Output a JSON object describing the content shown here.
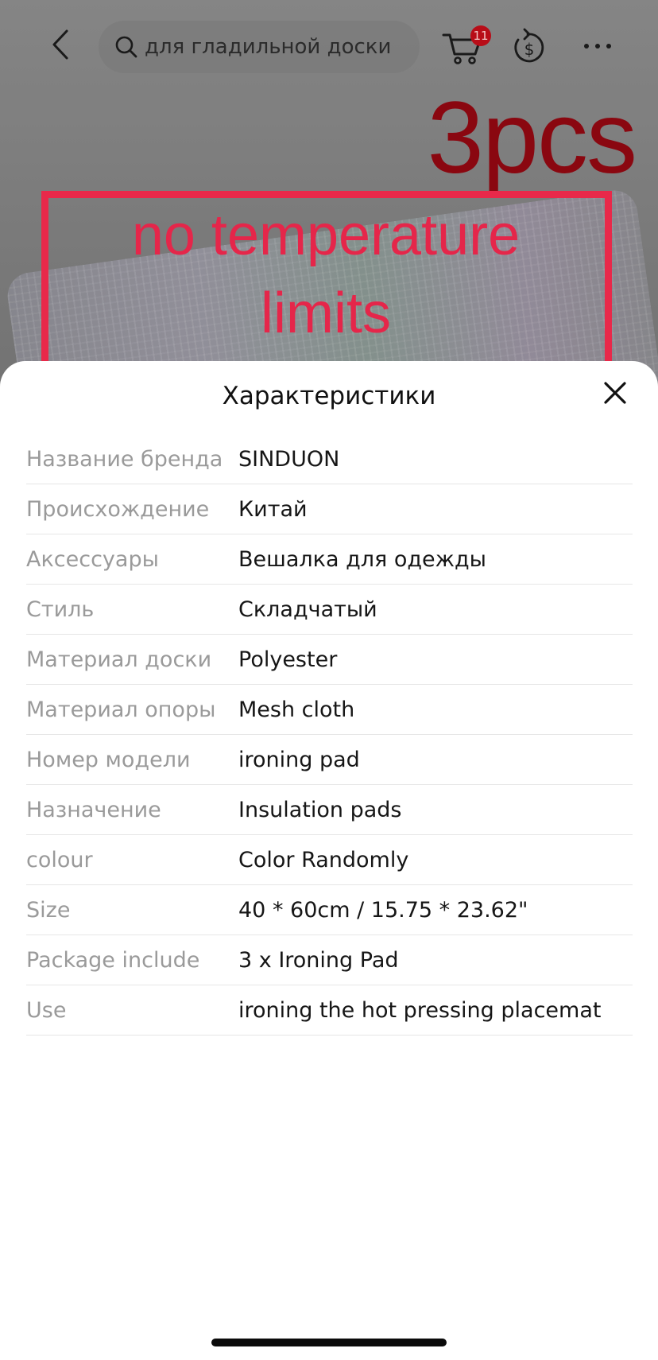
{
  "hero": {
    "overlay_pcs": "3pcs",
    "overlay_line1": "no temperature",
    "overlay_line2": "limits"
  },
  "nav": {
    "back_icon": "chevron-left-icon",
    "search_placeholder": "для гладильной доски",
    "cart_count": "11",
    "coin_icon": "coin-refresh-icon",
    "more_icon": "more-dots-icon"
  },
  "sheet": {
    "title": "Характеристики",
    "close_icon": "close-icon",
    "specs": [
      {
        "key": "Название бренда",
        "value": "SINDUON"
      },
      {
        "key": "Происхождение",
        "value": "Китай"
      },
      {
        "key": "Аксессуары",
        "value": "Вешалка для одежды"
      },
      {
        "key": "Стиль",
        "value": "Складчатый"
      },
      {
        "key": "Материал доски",
        "value": "Polyester"
      },
      {
        "key": "Материал опоры",
        "value": "Mesh cloth"
      },
      {
        "key": "Номер модели",
        "value": "ironing pad"
      },
      {
        "key": "Назначение",
        "value": "Insulation pads"
      },
      {
        "key": "colour",
        "value": "Color Randomly"
      },
      {
        "key": "Size",
        "value": "40 * 60cm / 15.75 * 23.62\""
      },
      {
        "key": "Package include",
        "value": "3 x Ironing Pad"
      },
      {
        "key": "Use",
        "value": "ironing the hot pressing placemat"
      }
    ]
  },
  "colors": {
    "accent_red": "#e8294a",
    "badge_red": "#b80d18",
    "label_gray": "#9a9a9a"
  }
}
